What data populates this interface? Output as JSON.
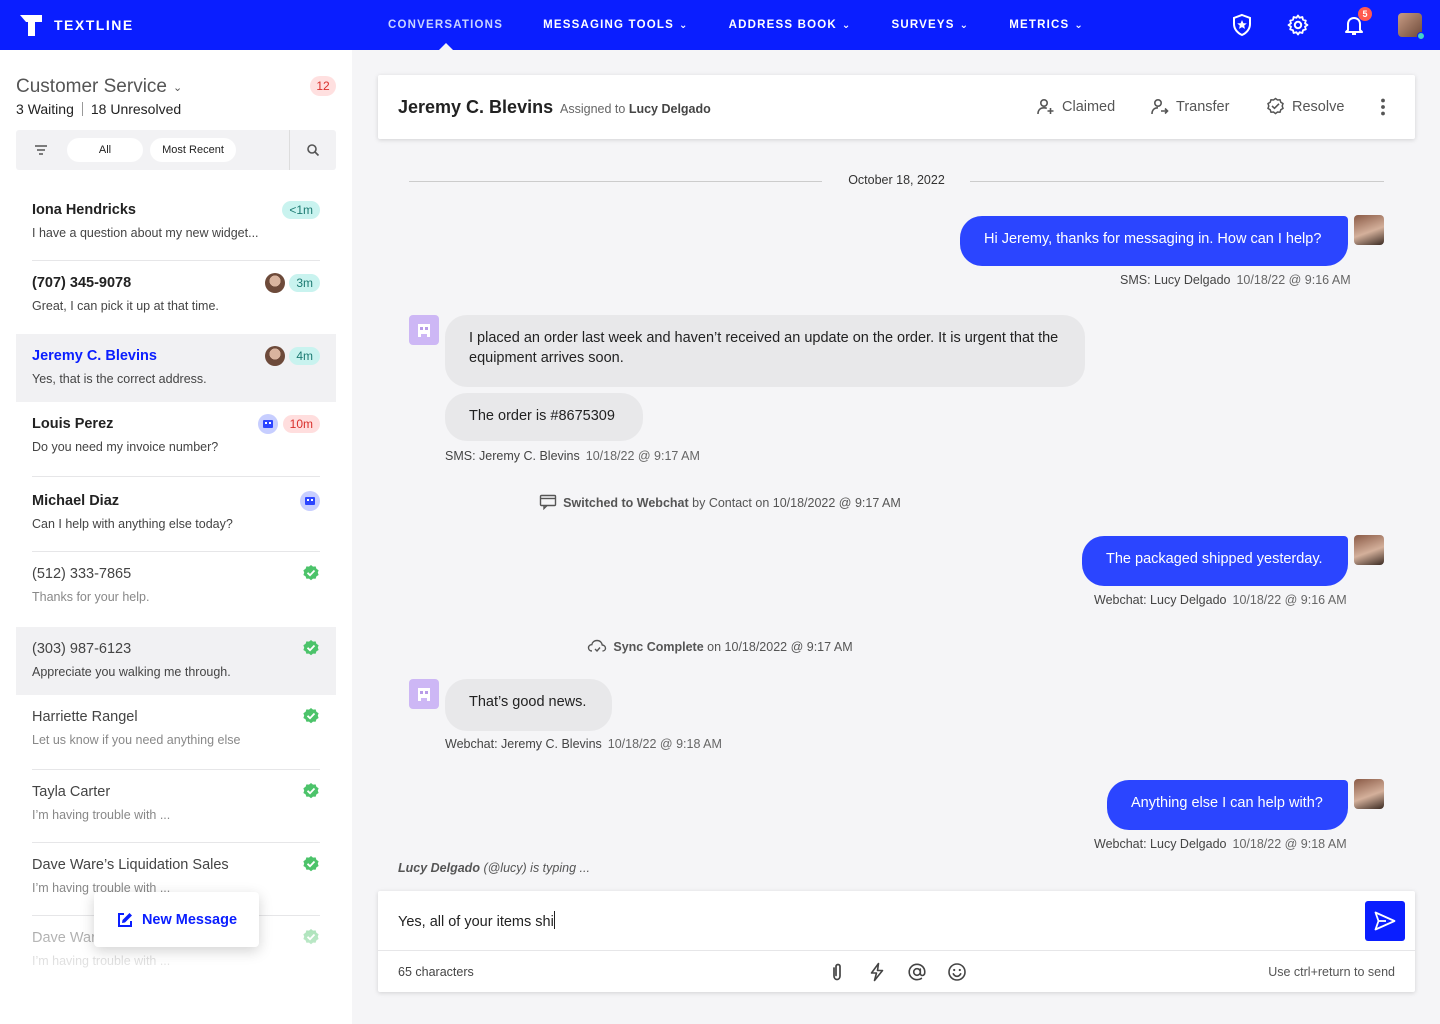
{
  "brand": {
    "name": "TEXTLINE"
  },
  "nav": {
    "items": [
      {
        "label": "CONVERSATIONS",
        "active": true,
        "dropdown": false
      },
      {
        "label": "MESSAGING TOOLS",
        "active": false,
        "dropdown": true
      },
      {
        "label": "ADDRESS BOOK",
        "active": false,
        "dropdown": true
      },
      {
        "label": "SURVEYS",
        "active": false,
        "dropdown": true
      },
      {
        "label": "METRICS",
        "active": false,
        "dropdown": true
      }
    ],
    "notifications": "5",
    "icons": [
      "shield-star-icon",
      "gear-icon",
      "bell-icon",
      "user-avatar"
    ]
  },
  "sidebar": {
    "inbox_name": "Customer Service",
    "inbox_count": "12",
    "waiting": "3",
    "waiting_label": "Waiting",
    "unresolved": "18",
    "unresolved_label": "Unresolved",
    "filter_all": "All",
    "filter_recent": "Most Recent",
    "new_message": "New Message",
    "conversations": [
      {
        "name": "Iona Hendricks",
        "preview": "I have a question about my new widget...",
        "badge": "<1m",
        "badge_color": "teal",
        "avatar": "none",
        "state": "open"
      },
      {
        "name": "(707) 345-9078",
        "preview": "Great, I can pick it up at that time.",
        "badge": "3m",
        "badge_color": "teal",
        "avatar": "agent",
        "state": "open"
      },
      {
        "name": "Jeremy C. Blevins",
        "preview": "Yes, that is the correct address.",
        "badge": "4m",
        "badge_color": "teal",
        "avatar": "agent",
        "state": "selected"
      },
      {
        "name": "Louis Perez",
        "preview": "Do you need my invoice number?",
        "badge": "10m",
        "badge_color": "red",
        "avatar": "bot",
        "state": "open"
      },
      {
        "name": "Michael Diaz",
        "preview": "Can I help with anything else today?",
        "badge": "",
        "badge_color": "",
        "avatar": "bot",
        "state": "open"
      },
      {
        "name": "(512) 333-7865",
        "preview": "Thanks for your help.",
        "badge": "",
        "avatar": "none",
        "state": "resolved"
      },
      {
        "name": "(303) 987-6123",
        "preview": "Appreciate you walking me through.",
        "badge": "",
        "avatar": "none",
        "state": "resolved-hl"
      },
      {
        "name": "Harriette Rangel",
        "preview": "Let us know if you need anything else",
        "badge": "",
        "avatar": "none",
        "state": "resolved"
      },
      {
        "name": "Tayla Carter",
        "preview": "I’m having trouble with ...",
        "badge": "",
        "avatar": "none",
        "state": "resolved"
      },
      {
        "name": "Dave Ware’s Liquidation Sales",
        "preview": "I’m having trouble with ...",
        "badge": "",
        "avatar": "none",
        "state": "resolved"
      },
      {
        "name": "Dave Ware’s Liquidation Sales",
        "preview": "I’m having trouble with ...",
        "badge": "",
        "avatar": "none",
        "state": "resolved"
      }
    ]
  },
  "header": {
    "contact_name": "Jeremy C. Blevins",
    "assigned_prefix": "Assigned to",
    "assigned_to": "Lucy Delgado",
    "actions": {
      "claimed": "Claimed",
      "transfer": "Transfer",
      "resolve": "Resolve"
    }
  },
  "thread": {
    "date": "October 18, 2022",
    "msg1": {
      "text": "Hi Jeremy, thanks for messaging in. How can I help?",
      "sender": "SMS: Lucy Delgado",
      "time": "10/18/22 @ 9:16 AM"
    },
    "msg2a": {
      "text": "I placed an order last week and haven’t received an update on the order. It is urgent that the equipment arrives soon."
    },
    "msg2b": {
      "text": "The order is #8675309",
      "sender": "SMS: Jeremy C. Blevins",
      "time": "10/18/22 @ 9:17 AM"
    },
    "event1": {
      "bold": "Switched to Webchat",
      "rest": "by Contact on 10/18/2022 @ 9:17 AM"
    },
    "msg3": {
      "text": "The packaged shipped yesterday.",
      "sender": "Webchat: Lucy Delgado",
      "time": "10/18/22 @ 9:16 AM"
    },
    "event2": {
      "bold": "Sync Complete",
      "rest": "on 10/18/2022 @ 9:17 AM"
    },
    "msg4": {
      "text": "That’s good news.",
      "sender": "Webchat: Jeremy C. Blevins",
      "time": "10/18/22 @ 9:18 AM"
    },
    "msg5": {
      "text": "Anything else I can help with?",
      "sender": "Webchat: Lucy Delgado",
      "time": "10/18/22 @ 9:18 AM"
    },
    "typing_name": "Lucy Delgado",
    "typing_rest": "(@lucy) is typing ..."
  },
  "composer": {
    "value": "Yes, all of your items shi",
    "char_count": "65 characters",
    "hint": "Use ctrl+return to send"
  },
  "colors": {
    "brand": "#0a1eff",
    "outgoing": "#2b45ff",
    "incoming": "#e8e8ea",
    "resolved": "#4cc36a"
  }
}
